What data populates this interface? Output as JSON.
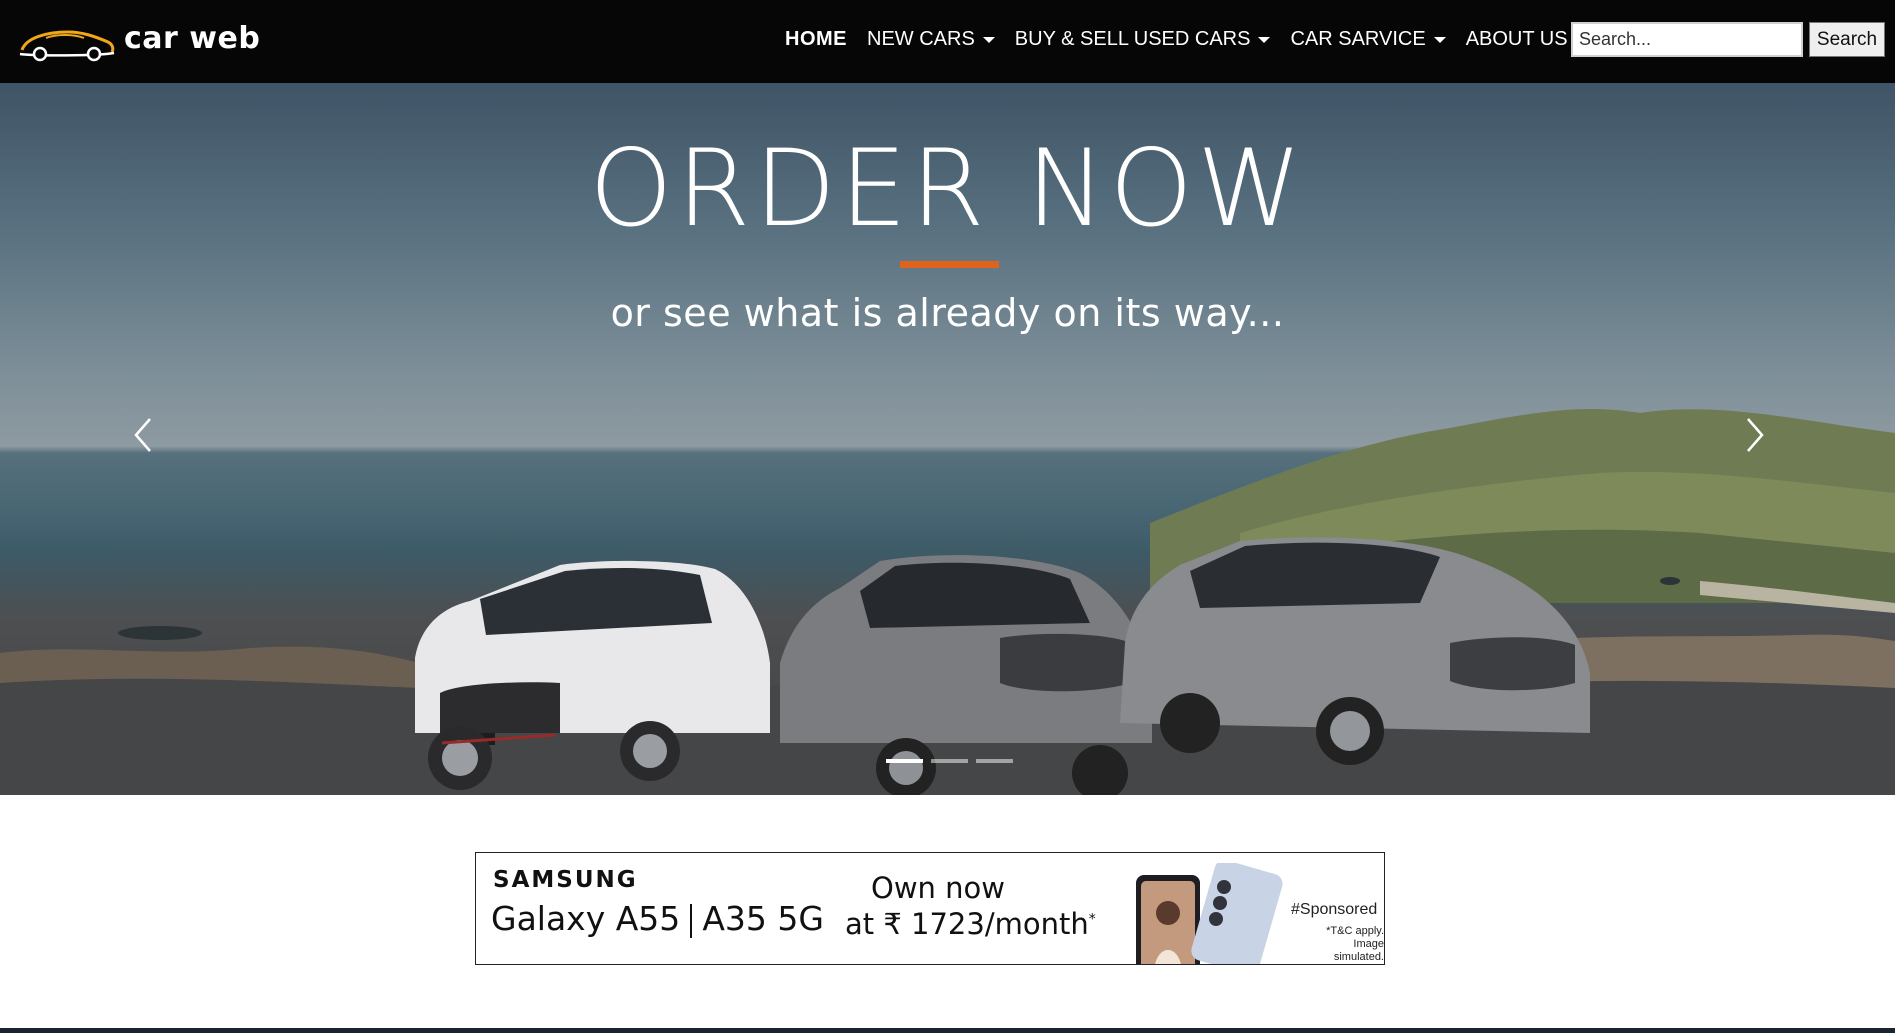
{
  "navbar": {
    "brand": {
      "logo_icon": "sports-car-logo-icon",
      "name": "car web"
    },
    "links": [
      {
        "label": "HOME",
        "active": true,
        "dropdown": false
      },
      {
        "label": "NEW CARS",
        "active": false,
        "dropdown": true
      },
      {
        "label": "BUY & SELL USED CARS",
        "active": false,
        "dropdown": true
      },
      {
        "label": "CAR SARVICE",
        "active": false,
        "dropdown": true
      },
      {
        "label": "ABOUT US",
        "active": false,
        "dropdown": false
      }
    ],
    "search": {
      "placeholder": "Search...",
      "button_label": "Search"
    }
  },
  "hero": {
    "title": "ORDER NOW",
    "subtitle": "or see what is already on its way...",
    "accent_color": "#e0621c",
    "prev_icon": "chevron-left-icon",
    "next_icon": "chevron-right-icon",
    "slide_count": 3,
    "active_slide": 1
  },
  "ad": {
    "brand": "SAMSUNG",
    "model_a": "Galaxy A55",
    "model_b": "A35 5G",
    "offer_line1": "Own now",
    "offer_line2": "at ₹ 1723/month",
    "offer_mark": "*",
    "sponsored": "#Sponsored",
    "terms_line1": "*T&C apply.",
    "terms_line2": "Image simulated."
  },
  "colors": {
    "navbar_bg": "#060606",
    "logo_accent": "#f0a81a",
    "footer_strip": "#1b2530"
  }
}
